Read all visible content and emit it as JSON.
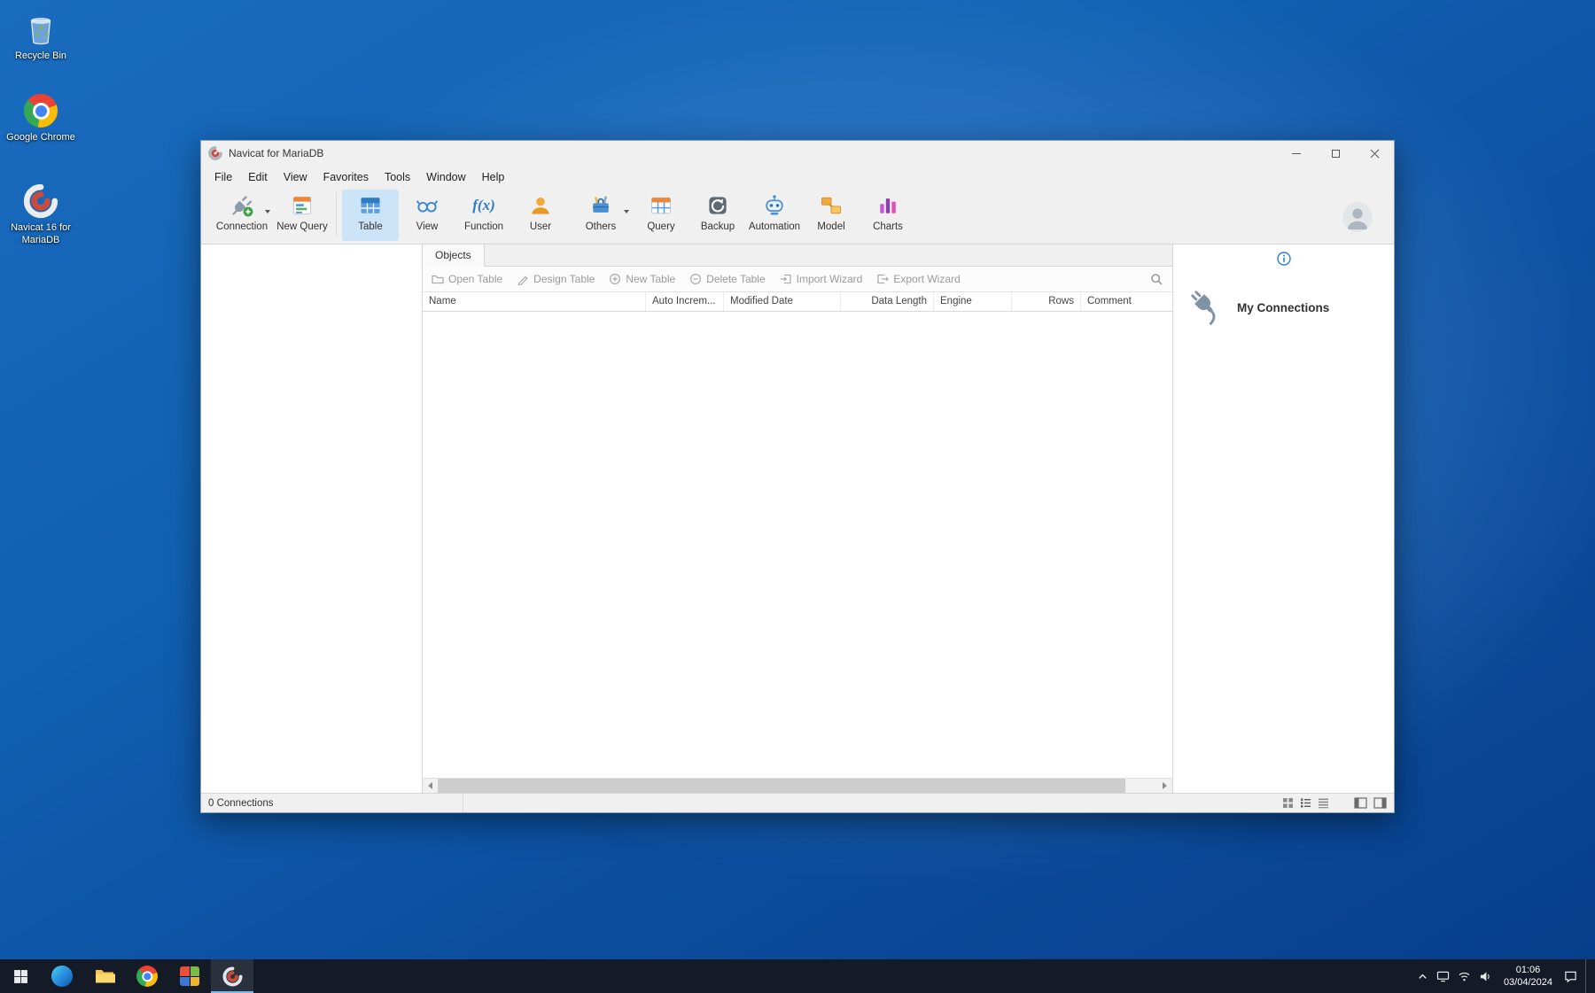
{
  "theme": {
    "accent_blue": "#2e7cc3",
    "toolbar_selected_bg": "#cce4f7",
    "taskbar_bg": "#141a26",
    "desktop_blue": "#1160b2",
    "disabled_text": "#9a9a9a"
  },
  "desktop": {
    "icons": [
      {
        "label": "Recycle Bin"
      },
      {
        "label": "Google Chrome"
      },
      {
        "label": "Navicat 16 for MariaDB"
      }
    ]
  },
  "window": {
    "title": "Navicat for MariaDB",
    "menu": [
      "File",
      "Edit",
      "View",
      "Favorites",
      "Tools",
      "Window",
      "Help"
    ],
    "toolbar": {
      "items": [
        {
          "label": "Connection",
          "has_dropdown": true
        },
        {
          "label": "New Query"
        },
        {
          "label": "Table",
          "active": true
        },
        {
          "label": "View"
        },
        {
          "label": "Function",
          "glyph": "f(x)"
        },
        {
          "label": "User"
        },
        {
          "label": "Others",
          "has_dropdown": true
        },
        {
          "label": "Query"
        },
        {
          "label": "Backup"
        },
        {
          "label": "Automation"
        },
        {
          "label": "Model"
        },
        {
          "label": "Charts"
        }
      ],
      "active_item": "Table"
    },
    "objects_tab": {
      "label": "Objects"
    },
    "object_toolbar": {
      "buttons": [
        {
          "label": "Open Table"
        },
        {
          "label": "Design Table"
        },
        {
          "label": "New Table"
        },
        {
          "label": "Delete Table"
        },
        {
          "label": "Import Wizard"
        },
        {
          "label": "Export Wizard"
        }
      ]
    },
    "table": {
      "headers": [
        "Name",
        "Auto Increm...",
        "Modified Date",
        "Data Length",
        "Engine",
        "Rows",
        "Comment"
      ],
      "rows": []
    },
    "right_panel": {
      "title": "My Connections"
    },
    "status_bar": {
      "text": "0 Connections"
    }
  },
  "taskbar": {
    "clock": {
      "time": "01:06",
      "date": "03/04/2024"
    }
  }
}
